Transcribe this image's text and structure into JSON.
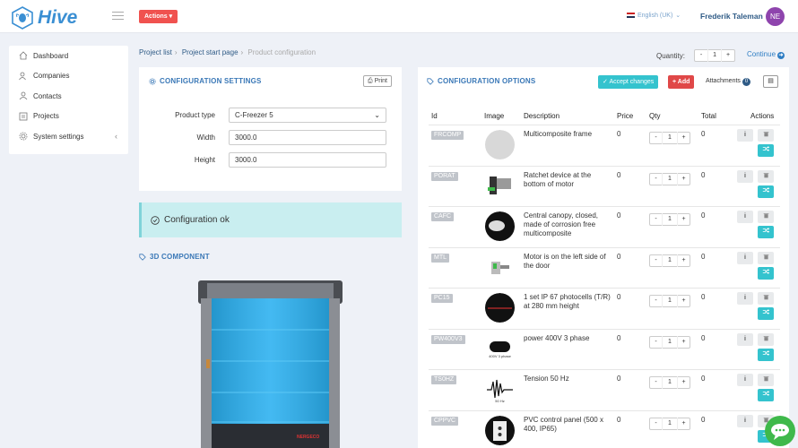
{
  "app": {
    "name": "Hive",
    "actions_label": "Actions",
    "language": "English (UK)",
    "user_name": "Frederik Taleman",
    "user_initials": "NE",
    "brand_color": "#3a8fd3"
  },
  "sidebar": {
    "items": [
      {
        "label": "Dashboard",
        "icon": "home-icon"
      },
      {
        "label": "Companies",
        "icon": "users-icon"
      },
      {
        "label": "Contacts",
        "icon": "contact-icon"
      },
      {
        "label": "Projects",
        "icon": "projects-icon"
      },
      {
        "label": "System settings",
        "icon": "gear-icon"
      }
    ]
  },
  "breadcrumb": {
    "items": [
      "Project list",
      "Project start page"
    ],
    "current": "Product configuration"
  },
  "quantity": {
    "label": "Quantity:",
    "value": "1",
    "minus": "-",
    "plus": "+"
  },
  "continue_label": "Continue",
  "settings": {
    "title": "CONFIGURATION SETTINGS",
    "print_label": "Print",
    "product_type_label": "Product type",
    "product_type_value": "C-Freezer 5",
    "width_label": "Width",
    "width_value": "3000.0",
    "height_label": "Height",
    "height_value": "3000.0"
  },
  "config_status": "Configuration ok",
  "component_title": "3D COMPONENT",
  "options": {
    "title": "CONFIGURATION OPTIONS",
    "accept_label": "Accept changes",
    "add_label": "Add",
    "attachments_label": "Attachments",
    "attachments_count": "0",
    "columns": [
      "Id",
      "Image",
      "Description",
      "Price",
      "Qty",
      "Total",
      "Actions"
    ],
    "rows": [
      {
        "id": "FRCOMP",
        "description": "Multicomposite frame",
        "price": "0",
        "qty": "1",
        "total": "0",
        "image": "grey-disc"
      },
      {
        "id": "PORAT",
        "description": "Ratchet device at the bottom of motor",
        "price": "0",
        "qty": "1",
        "total": "0",
        "image": "ratchet-device"
      },
      {
        "id": "CAFC",
        "description": "Central canopy, closed, made of corrosion free multicomposite",
        "price": "0",
        "qty": "1",
        "total": "0",
        "image": "canopy"
      },
      {
        "id": "MTL",
        "description": "Motor is on the left side of the door",
        "price": "0",
        "qty": "1",
        "total": "0",
        "image": "motor"
      },
      {
        "id": "PC15",
        "description": "1 set IP 67 photocells (T/R) at 280 mm height",
        "price": "0",
        "qty": "1",
        "total": "0",
        "image": "photocell"
      },
      {
        "id": "PW400V3",
        "description": "power 400V 3 phase",
        "price": "0",
        "qty": "1",
        "total": "0",
        "image": "power-plug",
        "image_caption": "400V 3 phase"
      },
      {
        "id": "TS0HZ",
        "description": "Tension 50 Hz",
        "price": "0",
        "qty": "1",
        "total": "0",
        "image": "wave",
        "image_caption": "50 Hz"
      },
      {
        "id": "CPPVC",
        "description": "PVC control panel (500 x 400, IP65)",
        "price": "0",
        "qty": "1",
        "total": "0",
        "image": "control-panel"
      }
    ]
  },
  "door_brand": "NERGECO"
}
